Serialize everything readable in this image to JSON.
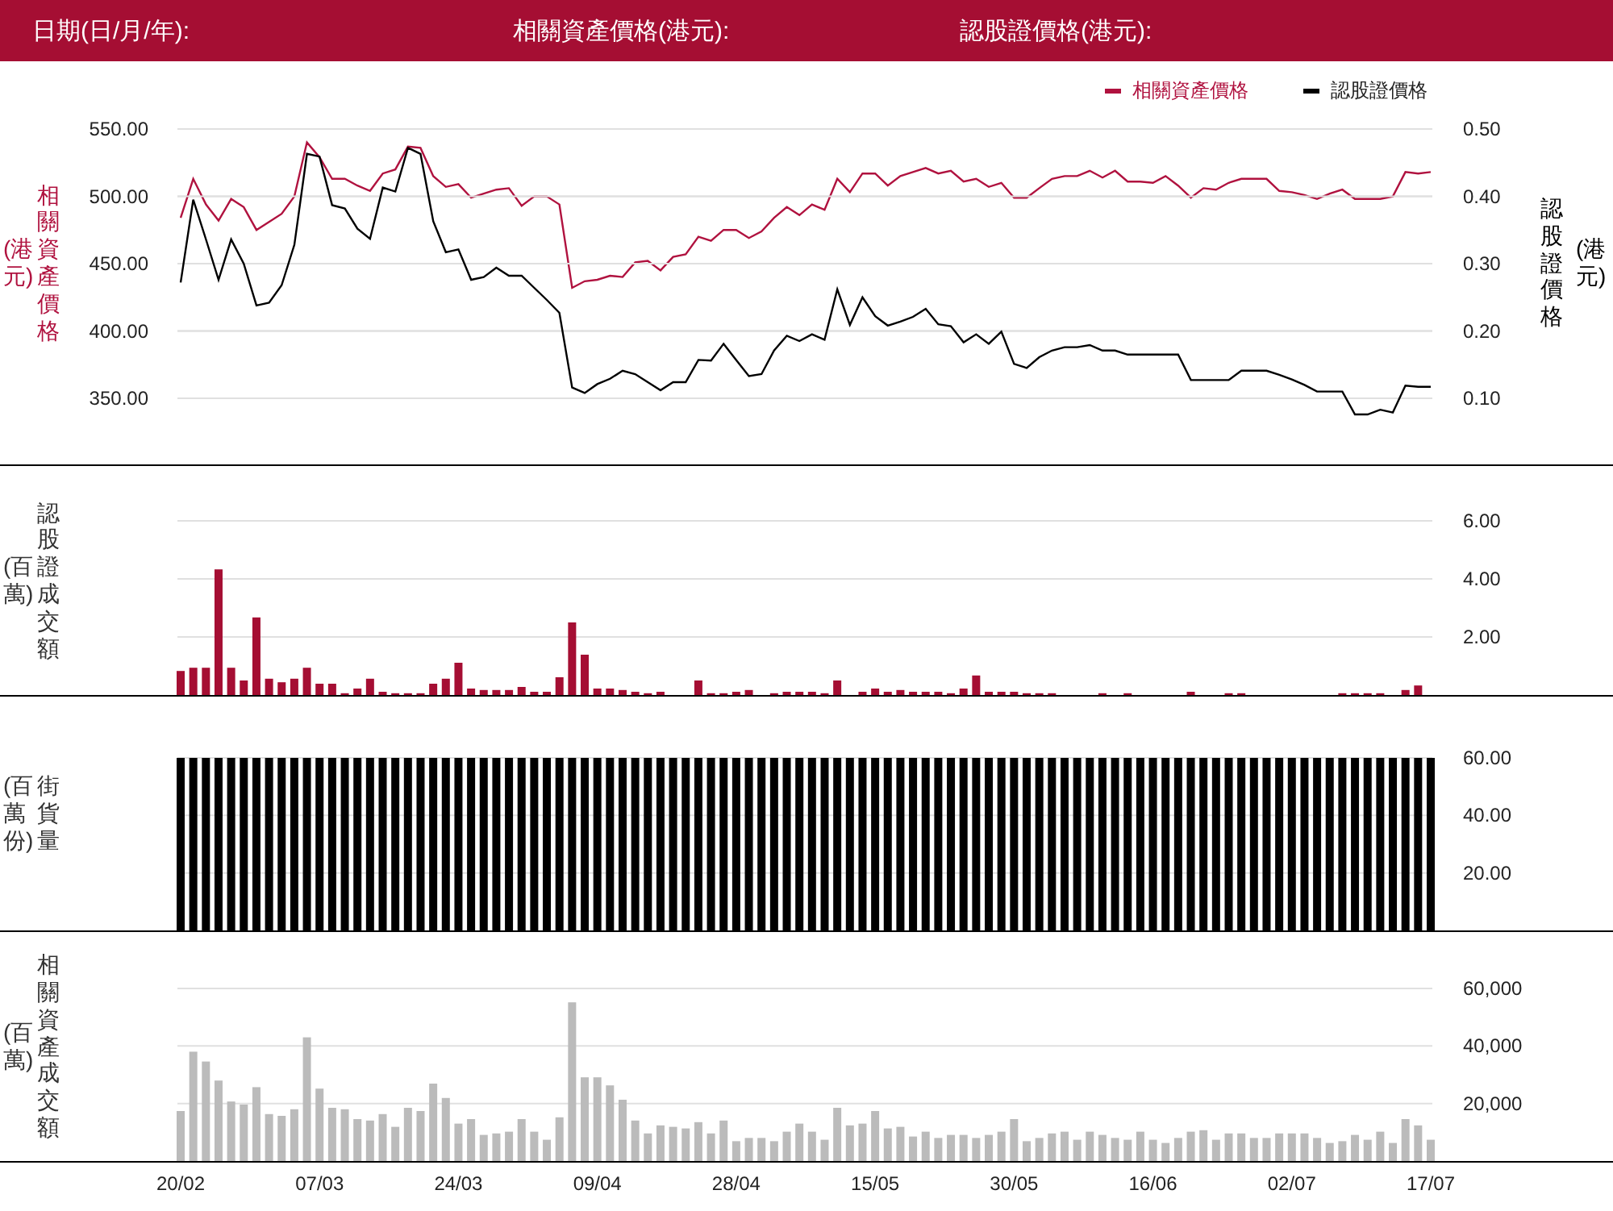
{
  "header": {
    "fields": [
      "日期(日/月/年):",
      "相關資產價格(港元):",
      "認股證價格(港元):"
    ]
  },
  "price_panel": {
    "left_title": "相關資產價格",
    "left_unit": "(港元)",
    "right_title": "認股證價格",
    "right_unit": "(港元)",
    "underlying": {
      "chart_data": {
        "type": "line",
        "grid": true,
        "series": [
          {
            "name": "相關資產價格",
            "color": "#b0123f",
            "values": [
              484,
              513,
              494,
              482,
              498,
              492,
              475,
              481,
              487,
              500,
              540,
              529,
              513,
              513,
              508,
              504,
              517,
              520,
              537,
              536,
              515,
              507,
              509,
              499,
              502,
              505,
              506,
              493,
              500,
              500,
              494,
              432,
              437,
              438,
              441,
              440,
              451,
              452,
              445,
              455,
              457,
              470,
              467,
              475,
              475,
              469,
              474,
              484,
              492,
              486,
              494,
              490,
              513,
              503,
              517,
              517,
              508,
              515,
              518,
              521,
              517,
              519,
              511,
              513,
              507,
              510,
              499,
              499,
              506,
              513,
              515,
              515,
              519,
              514,
              519,
              511,
              511,
              510,
              515,
              508,
              499,
              506,
              505,
              510,
              513,
              513,
              513,
              504,
              503,
              501,
              498,
              502,
              505,
              498,
              498,
              498,
              500,
              518,
              517,
              518
            ]
          }
        ],
        "ylim": [
          350,
          550
        ],
        "yticks": [
          {
            "value": 350,
            "label": "350.00"
          },
          {
            "value": 400,
            "label": "400.00"
          },
          {
            "value": 450,
            "label": "450.00"
          },
          {
            "value": 500,
            "label": "500.00"
          },
          {
            "value": 550,
            "label": "550.00"
          }
        ]
      }
    },
    "warrant": {
      "chart_data": {
        "type": "line",
        "grid": true,
        "series": [
          {
            "name": "認股證價格",
            "color": "#000000",
            "values": [
              0.272,
              0.395,
              0.336,
              0.276,
              0.336,
              0.3,
              0.238,
              0.242,
              0.268,
              0.328,
              0.463,
              0.459,
              0.387,
              0.382,
              0.352,
              0.337,
              0.413,
              0.407,
              0.472,
              0.463,
              0.363,
              0.317,
              0.321,
              0.276,
              0.28,
              0.294,
              0.282,
              0.282,
              0.264,
              0.246,
              0.227,
              0.116,
              0.108,
              0.121,
              0.129,
              0.141,
              0.136,
              0.124,
              0.112,
              0.124,
              0.124,
              0.157,
              0.156,
              0.181,
              0.157,
              0.133,
              0.136,
              0.171,
              0.193,
              0.185,
              0.195,
              0.187,
              0.262,
              0.209,
              0.25,
              0.222,
              0.208,
              0.214,
              0.221,
              0.233,
              0.21,
              0.207,
              0.183,
              0.195,
              0.181,
              0.199,
              0.151,
              0.145,
              0.161,
              0.171,
              0.176,
              0.176,
              0.179,
              0.171,
              0.171,
              0.165,
              0.165,
              0.165,
              0.165,
              0.165,
              0.127,
              0.127,
              0.127,
              0.127,
              0.141,
              0.141,
              0.141,
              0.135,
              0.128,
              0.12,
              0.11,
              0.11,
              0.11,
              0.076,
              0.076,
              0.083,
              0.079,
              0.119,
              0.117,
              0.117
            ]
          }
        ],
        "ylim": [
          0,
          0.5
        ],
        "yticks": [
          {
            "value": 0.1,
            "label": "0.10"
          },
          {
            "value": 0.2,
            "label": "0.20"
          },
          {
            "value": 0.3,
            "label": "0.30"
          },
          {
            "value": 0.4,
            "label": "0.40"
          },
          {
            "value": 0.5,
            "label": "0.50"
          }
        ]
      }
    }
  },
  "warrant_turnover_panel": {
    "unit": "(百萬)",
    "chart_data": {
      "type": "bar",
      "grid": true,
      "series": [
        {
          "name": "認股證成交額",
          "color": "#a50e33",
          "values": [
            0.83,
            0.94,
            0.94,
            4.33,
            0.94,
            0.5,
            2.67,
            0.56,
            0.44,
            0.56,
            0.94,
            0.39,
            0.39,
            0.06,
            0.22,
            0.56,
            0.11,
            0.06,
            0.06,
            0.06,
            0.39,
            0.56,
            1.11,
            0.22,
            0.17,
            0.17,
            0.17,
            0.28,
            0.11,
            0.11,
            0.61,
            2.5,
            1.39,
            0.22,
            0.22,
            0.17,
            0.11,
            0.06,
            0.11,
            0,
            0,
            0.5,
            0.06,
            0.06,
            0.11,
            0.17,
            0,
            0.06,
            0.11,
            0.11,
            0.11,
            0.06,
            0.5,
            0,
            0.11,
            0.22,
            0.11,
            0.17,
            0.11,
            0.11,
            0.11,
            0.06,
            0.22,
            0.67,
            0.11,
            0.11,
            0.11,
            0.06,
            0.06,
            0.06,
            0,
            0,
            0,
            0.06,
            0,
            0.06,
            0,
            0,
            0,
            0,
            0.11,
            0,
            0,
            0.06,
            0.06,
            0,
            0,
            0,
            0,
            0,
            0,
            0,
            0.06,
            0.06,
            0.06,
            0.06,
            0,
            0.17,
            0.33,
            0
          ]
        }
      ],
      "ylim": [
        0,
        6
      ],
      "yticks": [
        {
          "value": 2,
          "label": "2.00"
        },
        {
          "value": 4,
          "label": "4.00"
        },
        {
          "value": 6,
          "label": "6.00"
        }
      ]
    }
  },
  "outstanding_panel": {
    "unit": "(百萬份)",
    "chart_data": {
      "type": "bar",
      "grid": true,
      "series": [
        {
          "name": "街貨量",
          "color": "#000000",
          "values": [
            60,
            60,
            60,
            60,
            60,
            60,
            60,
            60,
            60,
            60,
            60,
            60,
            60,
            60,
            60,
            60,
            60,
            60,
            60,
            60,
            60,
            60,
            60,
            60,
            60,
            60,
            60,
            60,
            60,
            60,
            60,
            60,
            60,
            60,
            60,
            60,
            60,
            60,
            60,
            60,
            60,
            60,
            60,
            60,
            60,
            60,
            60,
            60,
            60,
            60,
            60,
            60,
            60,
            60,
            60,
            60,
            60,
            60,
            60,
            60,
            60,
            60,
            60,
            60,
            60,
            60,
            60,
            60,
            60,
            60,
            60,
            60,
            60,
            60,
            60,
            60,
            60,
            60,
            60,
            60,
            60,
            60,
            60,
            60,
            60,
            60,
            60,
            60,
            60,
            60,
            60,
            60,
            60,
            60,
            60,
            60,
            60,
            60,
            60,
            60
          ]
        }
      ],
      "ylim": [
        0,
        60
      ],
      "yticks": [
        {
          "value": 20,
          "label": "20.00"
        },
        {
          "value": 40,
          "label": "40.00"
        },
        {
          "value": 60,
          "label": "60.00"
        }
      ]
    }
  },
  "underlying_turnover_panel": {
    "unit": "(百萬)",
    "x_labels": [
      "20/02",
      "07/03",
      "24/03",
      "09/04",
      "28/04",
      "15/05",
      "30/05",
      "16/06",
      "02/07",
      "17/07"
    ],
    "chart_data": {
      "type": "bar",
      "grid": true,
      "series": [
        {
          "name": "相關資產成交額",
          "color": "#bbbbbb",
          "values": [
            17400,
            38000,
            34600,
            28000,
            20700,
            19600,
            25700,
            16300,
            15700,
            18000,
            43000,
            25200,
            18500,
            18000,
            14600,
            14100,
            16300,
            11900,
            18500,
            17400,
            26900,
            21900,
            13000,
            14600,
            9100,
            9600,
            10200,
            14600,
            10200,
            7400,
            15200,
            55200,
            29100,
            29100,
            26300,
            21300,
            14100,
            9600,
            12400,
            11900,
            11300,
            13500,
            9600,
            14100,
            6900,
            8000,
            8000,
            6900,
            10200,
            13000,
            10200,
            7400,
            18500,
            12400,
            13000,
            17400,
            11300,
            11900,
            8500,
            10200,
            8000,
            9100,
            9100,
            8000,
            9100,
            10200,
            14600,
            6900,
            8000,
            9600,
            10200,
            7400,
            10200,
            9100,
            8000,
            7400,
            10200,
            7400,
            6300,
            8000,
            10200,
            10700,
            7400,
            9600,
            9600,
            8000,
            8000,
            9600,
            9600,
            9600,
            8000,
            6300,
            6900,
            9100,
            7400,
            10200,
            6300,
            14600,
            12400,
            7400
          ]
        }
      ],
      "ylim": [
        0,
        60000
      ],
      "yticks": [
        {
          "value": 20000,
          "label": "20,000"
        },
        {
          "value": 40000,
          "label": "40,000"
        },
        {
          "value": 60000,
          "label": "60,000"
        }
      ]
    }
  }
}
